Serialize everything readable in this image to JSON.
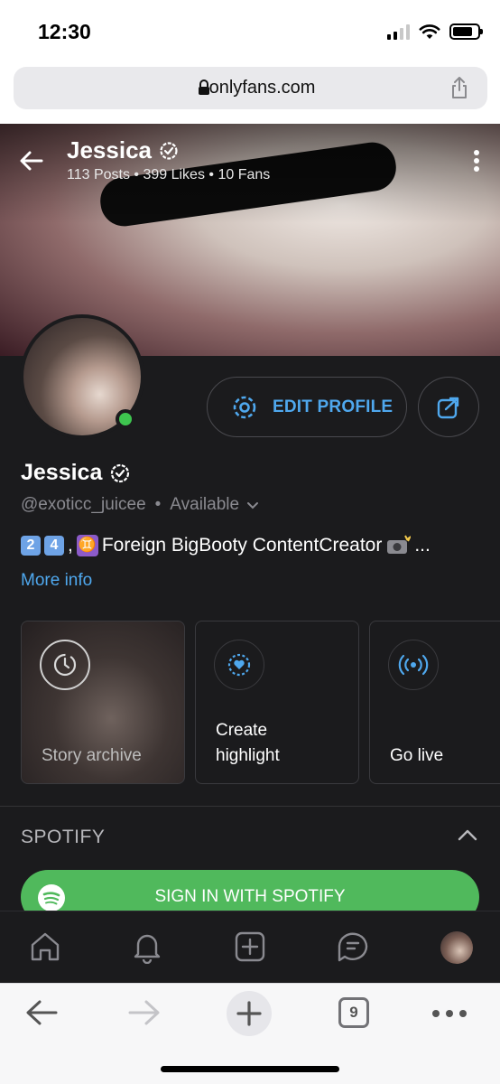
{
  "status_bar": {
    "time": "12:30"
  },
  "browser": {
    "url": "onlyfans.com",
    "tab_count": "9"
  },
  "profile": {
    "cover_name": "Jessica",
    "cover_stats": "113 Posts  •  399 Likes  •  10 Fans",
    "display_name": "Jessica",
    "handle": "@exoticc_juicee",
    "separator": "•",
    "availability": "Available",
    "bio_after_emoji": "Foreign BigBooty ContentCreator",
    "bio_keycaps": [
      "2",
      "4"
    ],
    "bio_comma": ",",
    "bio_ellipsis": "...",
    "more_info": "More info",
    "edit_profile_label": "EDIT PROFILE"
  },
  "cards": [
    {
      "label": "Story archive",
      "icon": "clock-icon"
    },
    {
      "label": "Create highlight",
      "icon": "heart-icon"
    },
    {
      "label": "Go live",
      "icon": "broadcast-icon"
    }
  ],
  "spotify": {
    "title": "SPOTIFY",
    "button_label": "SIGN IN WITH SPOTIFY"
  },
  "nav": [
    "home-icon",
    "bell-icon",
    "add-post-icon",
    "messages-icon",
    "profile-avatar"
  ],
  "colors": {
    "accent": "#4fa8ee",
    "online": "#3ec54f",
    "spotify": "#50b95c",
    "background": "#1b1b1d"
  }
}
